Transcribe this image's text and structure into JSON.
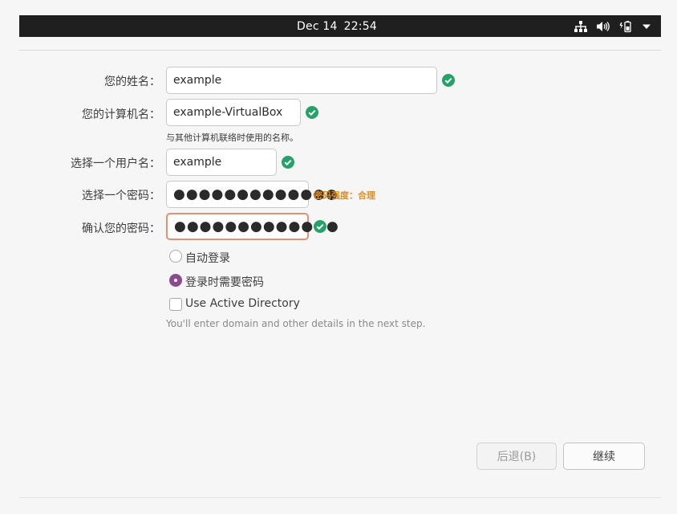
{
  "topbar": {
    "date": "Dec 14",
    "time": "22:54",
    "icons": [
      "network-wired-icon",
      "volume-icon",
      "battery-icon",
      "system-menu-arrow-icon"
    ]
  },
  "form": {
    "name": {
      "label": "您的姓名：",
      "value": "example",
      "valid": true
    },
    "computer": {
      "label": "您的计算机名：",
      "value": "example-VirtualBox",
      "valid": true,
      "hint": "与其他计算机联络时使用的名称。"
    },
    "username": {
      "label": "选择一个用户名：",
      "value": "example",
      "valid": true
    },
    "password": {
      "label": "选择一个密码：",
      "value": "●●●●●●●●●●●●●",
      "strength": "密码强度：合理"
    },
    "confirm": {
      "label": "确认您的密码：",
      "value": "●●●●●●●●●●●●●",
      "valid": true
    }
  },
  "options": {
    "auto_login": {
      "label": "自动登录",
      "selected": false
    },
    "require_password": {
      "label": "登录时需要密码",
      "selected": true
    },
    "active_directory": {
      "label": "Use Active Directory",
      "checked": false,
      "note": "You'll enter domain and other details in the next step."
    }
  },
  "buttons": {
    "back": "后退(B)",
    "continue": "继续"
  },
  "colors": {
    "valid": "#26a269",
    "radio_accent": "#8e4a8f",
    "strength": "#e58c1a",
    "focus_border": "#e4906a"
  }
}
